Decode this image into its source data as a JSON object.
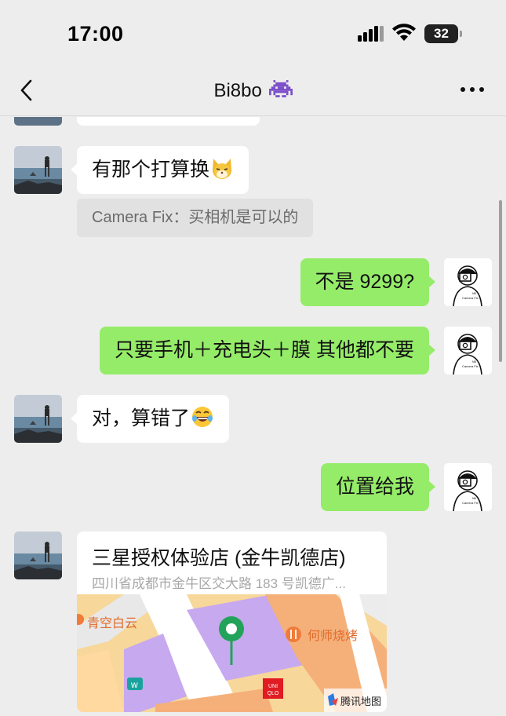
{
  "status_bar": {
    "time": "17:00",
    "battery_level": "32",
    "icons": [
      "cellular-signal-icon",
      "wifi-icon",
      "battery-icon"
    ]
  },
  "header": {
    "title": "Bi8bo",
    "title_emoji": "alien-monster-emoji",
    "back_icon": "chevron-left-icon",
    "more_icon": "more-dots-icon"
  },
  "messages": [
    {
      "side": "in",
      "text": "有那个打算换",
      "emoji": "cat-face-emoji"
    },
    {
      "side": "quote",
      "text": "Camera Fix：买相机是可以的"
    },
    {
      "side": "out",
      "text": "不是 9299?"
    },
    {
      "side": "out",
      "text": "只要手机＋充电头＋膜  其他都不要"
    },
    {
      "side": "in",
      "text": "对，算错了",
      "emoji": "rolling-laughing-emoji"
    },
    {
      "side": "out",
      "text": "位置给我"
    },
    {
      "side": "in",
      "type": "location",
      "name": "三星授权体验店 (金牛凯德店)",
      "address": "四川省成都市金牛区交大路 183 号凯德广...",
      "map_labels": {
        "label_1": "青空白云",
        "label_2": "何师烧烤",
        "brand": "UNI QLO",
        "provider": "腾讯地图"
      }
    }
  ],
  "avatars": {
    "contact": "avatar-beach-photo",
    "me_caption": "Camera Fix"
  },
  "colors": {
    "background": "#ededed",
    "outgoing_bubble": "#95ec69",
    "incoming_bubble": "#ffffff",
    "quote_bg": "#e1e1e1"
  }
}
